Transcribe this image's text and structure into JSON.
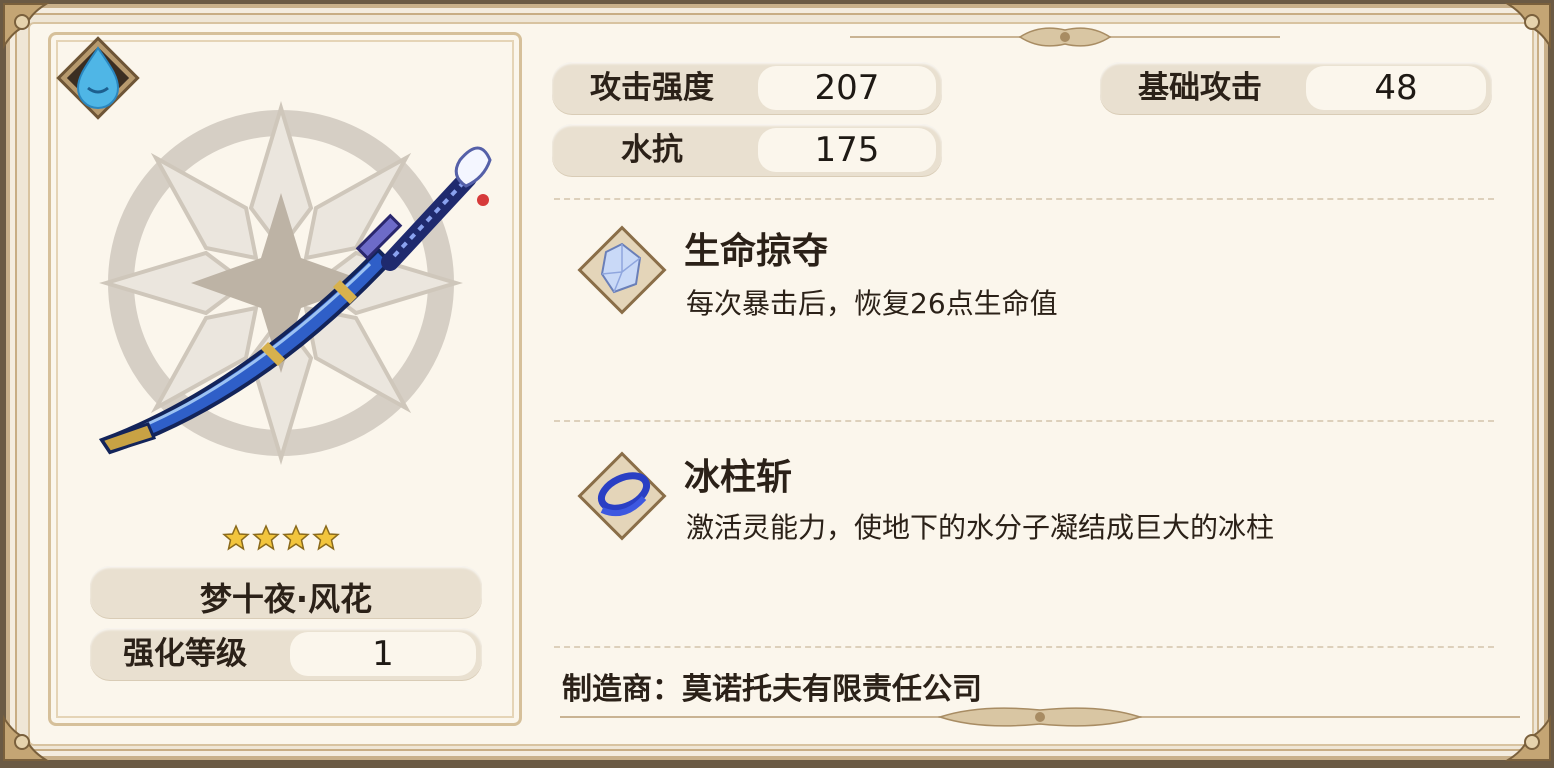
{
  "weapon": {
    "name": "梦十夜·风花",
    "stars": 4,
    "element_icon": "water-drop-icon",
    "enhance_label": "强化等级",
    "enhance_value": "1"
  },
  "stats": {
    "attack_label": "攻击强度",
    "attack_value": "207",
    "base_attack_label": "基础攻击",
    "base_attack_value": "48",
    "water_res_label": "水抗",
    "water_res_value": "175"
  },
  "skills": [
    {
      "title": "生命掠夺",
      "desc": "每次暴击后，恢复26点生命值",
      "icon": "crystal-icon"
    },
    {
      "title": "冰柱斩",
      "desc": "激活灵能力，使地下的水分子凝结成巨大的冰柱",
      "icon": "blue-swirl-icon"
    }
  ],
  "maker": "制造商：莫诺托夫有限责任公司",
  "colors": {
    "panel": "#fbf6ec",
    "border": "#c8ad84",
    "pill": "#e9e0d0",
    "text": "#2b2118",
    "blade_blue": "#2f5fc8",
    "water_icon": "#4fb6e6"
  }
}
